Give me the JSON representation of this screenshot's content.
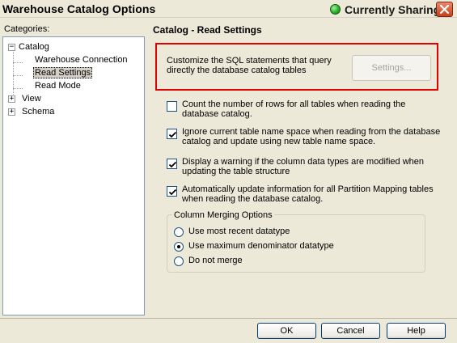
{
  "window": {
    "title": "Warehouse Catalog Options",
    "sharing_status": "Currently Sharing",
    "sharing_color": "#27a627"
  },
  "categories": {
    "label": "Categories:",
    "tree": [
      {
        "label": "Catalog",
        "expander": "−"
      },
      {
        "label": "Warehouse Connection"
      },
      {
        "label": "Read Settings",
        "selected": true
      },
      {
        "label": "Read Mode"
      },
      {
        "label": "View",
        "expander": "+"
      },
      {
        "label": "Schema",
        "expander": "+"
      }
    ]
  },
  "panel": {
    "title": "Catalog - Read Settings",
    "sql_text": "Customize the SQL statements that query directly the database catalog tables",
    "settings_button": "Settings...",
    "highlight_color": "#e00000",
    "checkboxes": [
      {
        "label": "Count the number of rows for all tables when reading the database catalog.",
        "checked": false
      },
      {
        "label": "Ignore current table name space when reading from the database catalog and update using new table name space.",
        "checked": true
      },
      {
        "label": "Display a warning if the column data types are modified when updating the table structure",
        "checked": true
      },
      {
        "label": "Automatically update information for all Partition Mapping tables when reading the database catalog.",
        "checked": true
      }
    ],
    "column_merging": {
      "title": "Column Merging Options",
      "options": [
        {
          "label": "Use most recent datatype",
          "selected": false
        },
        {
          "label": "Use maximum denominator datatype",
          "selected": true
        },
        {
          "label": "Do not merge",
          "selected": false
        }
      ]
    }
  },
  "buttons": {
    "ok": "OK",
    "cancel": "Cancel",
    "help": "Help"
  },
  "icons": {
    "close": "close-icon",
    "status": "status-dot-icon",
    "check": "checkmark-icon"
  }
}
